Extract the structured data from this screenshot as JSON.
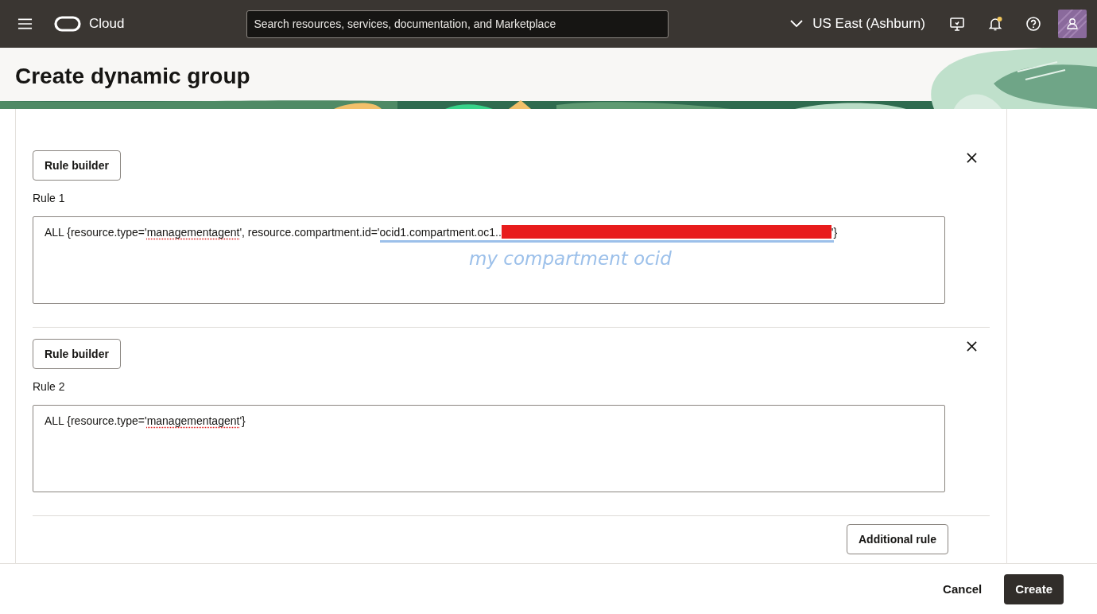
{
  "topbar": {
    "brand": "Cloud",
    "search": {
      "placeholder": "Search resources, services, documentation, and Marketplace"
    },
    "region": "US East (Ashburn)",
    "notification_unread": true
  },
  "page": {
    "title": "Create dynamic group"
  },
  "rules": [
    {
      "builder_button": "Rule builder",
      "label": "Rule 1",
      "segments": [
        {
          "kind": "text",
          "text": "ALL {resource.type='",
          "marked": false
        },
        {
          "kind": "misspelled",
          "text": "managementagent",
          "marked": false
        },
        {
          "kind": "text",
          "text": "', resource.compartment.id='",
          "marked": false
        },
        {
          "kind": "text",
          "text": "ocid1.compartment.oc1..",
          "marked": true
        },
        {
          "kind": "redacted",
          "marked": true
        },
        {
          "kind": "text",
          "text": "'",
          "marked": true
        },
        {
          "kind": "text",
          "text": "}",
          "marked": false
        }
      ],
      "annotation": "my compartment ocid"
    },
    {
      "builder_button": "Rule builder",
      "label": "Rule 2",
      "segments": [
        {
          "kind": "text",
          "text": "ALL {resource.type='",
          "marked": false
        },
        {
          "kind": "misspelled",
          "text": "managementagent",
          "marked": false
        },
        {
          "kind": "text",
          "text": "'}",
          "marked": false
        }
      ]
    }
  ],
  "additional_rule_button": "Additional rule",
  "footer": {
    "buttons": [
      {
        "label": "Cancel",
        "kind": "secondary"
      },
      {
        "label": "Create",
        "kind": "primary"
      }
    ]
  }
}
